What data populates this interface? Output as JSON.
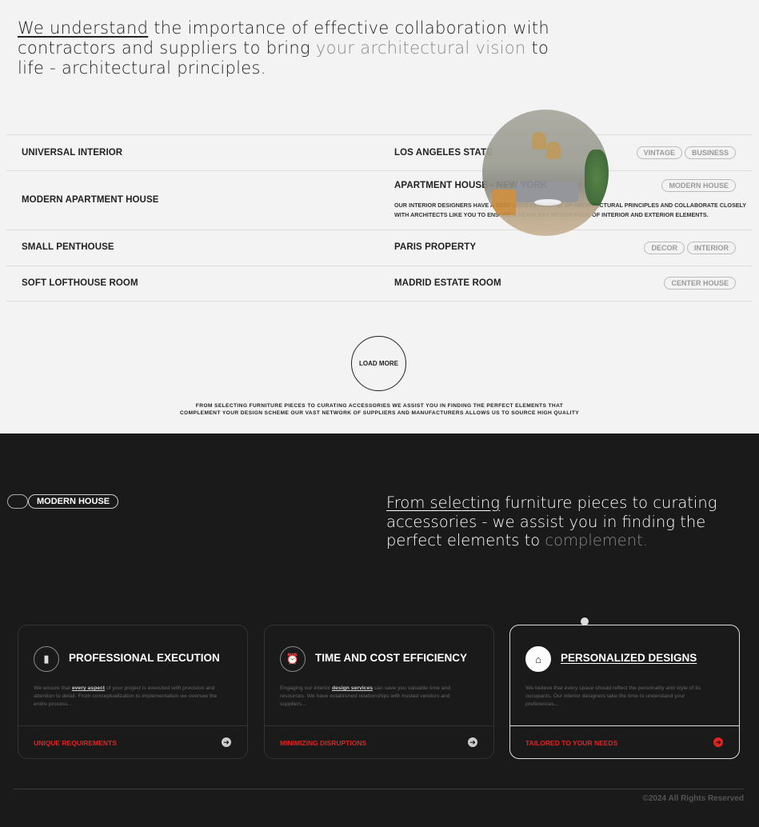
{
  "intro": {
    "underlined": "We understand",
    "text1": " the importance of effective collaboration with contractors and suppliers to bring ",
    "highlight": "your architectural vision",
    "text2": " to life - architectural principles."
  },
  "rows": [
    {
      "left": "UNIVERSAL INTERIOR",
      "right": "LOS ANGELES STATE",
      "tags": [
        "VINTAGE",
        "BUSINESS"
      ]
    },
    {
      "left": "MODERN APARTMENT HOUSE",
      "right": "APARTMENT HOUSE - NEW YORK",
      "tags": [
        "MODERN HOUSE"
      ],
      "desc": "OUR INTERIOR DESIGNERS HAVE A DEEP UNDERSTANDING OF ARCHITECTURAL PRINCIPLES AND COLLABORATE CLOSELY WITH ARCHITECTS LIKE YOU TO ENSURE A SEAMLESS INTEGRATION OF INTERIOR AND EXTERIOR ELEMENTS."
    },
    {
      "left": "SMALL PENTHOUSE",
      "right": "PARIS PROPERTY",
      "tags": [
        "DECOR",
        "INTERIOR"
      ]
    },
    {
      "left": "SOFT LOFTHOUSE ROOM",
      "right": "MADRID ESTATE ROOM",
      "tags": [
        "CENTER HOUSE"
      ]
    }
  ],
  "load_more": "LOAD MORE",
  "small_text": {
    "line1": "FROM SELECTING FURNITURE PIECES TO CURATING ACCESSORIES  WE ASSIST YOU IN FINDING THE PERFECT ELEMENTS THAT",
    "line2": "COMPLEMENT YOUR DESIGN SCHEME  OUR VAST NETWORK OF SUPPLIERS AND MANUFACTURERS ALLOWS US TO SOURCE HIGH  QUALITY"
  },
  "pill": "MODERN HOUSE",
  "right_heading": {
    "underlined": "From selecting",
    "text": " furniture pieces to curating accessories - we assist you in finding the perfect elements to ",
    "grey": "complement."
  },
  "cards": [
    {
      "icon": "bookmark-icon",
      "title": "PROFESSIONAL EXECUTION",
      "pre": "We ensure that ",
      "bold": "every aspect",
      "post": " of your project is executed with precision and attention to detail. From conceptualization to implementation we oversee the entire process...",
      "link": "UNIQUE REQUIREMENTS"
    },
    {
      "icon": "alarm-clock-icon",
      "title": "TIME AND COST EFFICIENCY",
      "pre": "Engaging our interior ",
      "bold": "design services",
      "post": " can save you valuable time and resources. We have established relationships with trusted vendors and suppliers...",
      "link": "MINIMIZING DISRUPTIONS"
    },
    {
      "icon": "home-icon",
      "title": "PERSONALIZED DESIGNS",
      "pre": "We believe that every space should reflect the personality and style of its occupants. Our interior designers take the time to understand your preferences...",
      "bold": "",
      "post": "",
      "link": "TAILORED TO YOUR NEEDS"
    }
  ],
  "footer": {
    "copyright": "©2024 All Rights Reserved"
  },
  "colors": {
    "accent": "#e02424",
    "dark_bg": "#1a1a1a",
    "light_bg": "#f3f3f3"
  }
}
